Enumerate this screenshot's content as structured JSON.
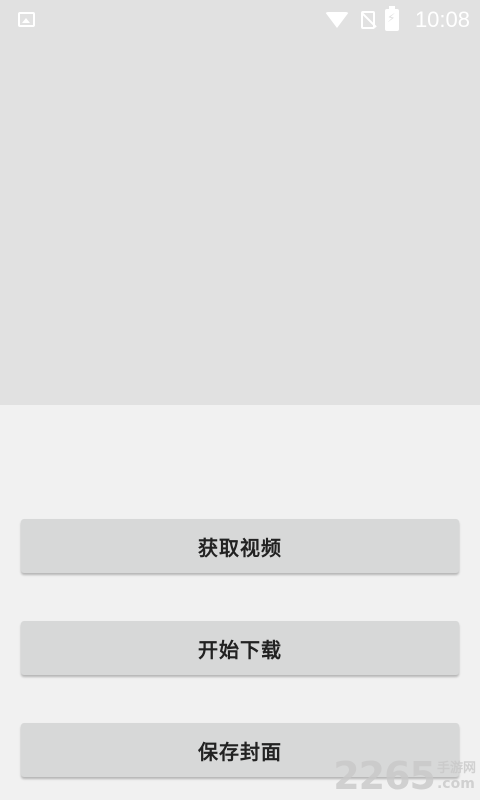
{
  "status_bar": {
    "time": "10:08",
    "icons": [
      "image-notification-icon",
      "wifi-icon",
      "no-sim-icon",
      "battery-charging-icon"
    ]
  },
  "video": {
    "placeholder_color": "#e1e1e1"
  },
  "buttons": {
    "get_video": "获取视频",
    "start_download": "开始下载",
    "save_cover": "保存封面"
  },
  "watermark": {
    "main": "2265",
    "sub": "手游网",
    "domain": ".com"
  }
}
